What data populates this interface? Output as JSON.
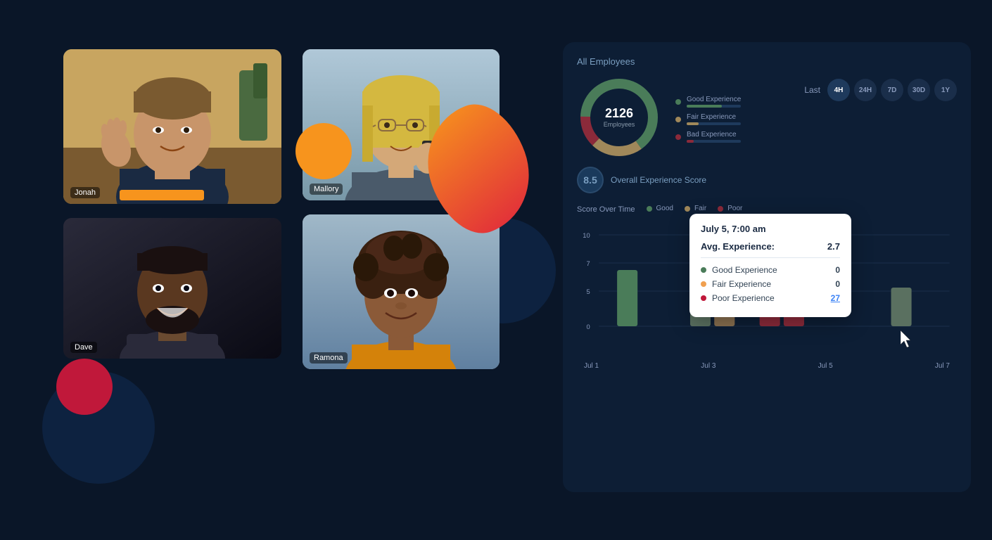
{
  "background": {
    "color": "#0a1628"
  },
  "left_panel": {
    "tiles": [
      {
        "id": "jonah",
        "name": "Jonah",
        "position": "top-left",
        "bg_color": "#8b6914"
      },
      {
        "id": "dave",
        "name": "Dave",
        "position": "bottom-left",
        "bg_color": "#1a1a1a"
      },
      {
        "id": "mallory",
        "name": "Mallory",
        "position": "top-right",
        "bg_color": "#c49040"
      },
      {
        "id": "ramona",
        "name": "Ramona",
        "position": "bottom-right",
        "bg_color": "#6b3e2c"
      }
    ]
  },
  "right_panel": {
    "section_label": "All Employees",
    "donut": {
      "value": "2126",
      "sub": "Employees",
      "good_pct": 65,
      "fair_pct": 22,
      "bad_pct": 13
    },
    "legend": [
      {
        "label": "Good Experience",
        "color": "#4a7c59",
        "pct": 65
      },
      {
        "label": "Fair Experience",
        "color": "#a0885a",
        "pct": 22
      },
      {
        "label": "Bad Experience",
        "color": "#8b2a3a",
        "pct": 13
      }
    ],
    "time_filter": {
      "label": "Last",
      "options": [
        "4H",
        "24H",
        "7D",
        "30D",
        "1Y"
      ],
      "active": "4H"
    },
    "score": {
      "value": "8.5",
      "label": "Overall Experience Score"
    },
    "chart": {
      "title": "Score Over Time",
      "legend": [
        {
          "label": "Good",
          "color": "#4a7c59"
        },
        {
          "label": "Fair",
          "color": "#a0885a"
        },
        {
          "label": "Poor",
          "color": "#8b2a3a"
        }
      ],
      "x_labels": [
        "Jul 1",
        "Jul 3",
        "Jul 5",
        "Jul 7"
      ],
      "y_labels": [
        "10",
        "7",
        "5",
        "0"
      ],
      "bars": [
        {
          "x": "Jul 1",
          "good": 70,
          "fair": 0,
          "poor": 0
        },
        {
          "x": "Jul 3",
          "good": 50,
          "fair": 30,
          "poor": 10
        },
        {
          "x": "Jul 5",
          "good": 0,
          "fair": 0,
          "poor": 80
        },
        {
          "x": "Jul 5b",
          "good": 0,
          "fair": 0,
          "poor": 60
        },
        {
          "x": "Jul 7",
          "good": 45,
          "fair": 0,
          "poor": 0
        }
      ]
    },
    "tooltip": {
      "date": "July 5, 7:00 am",
      "avg_label": "Avg. Experience:",
      "avg_value": "2.7",
      "rows": [
        {
          "label": "Good Experience",
          "color": "#4a7c59",
          "value": "0",
          "is_link": false
        },
        {
          "label": "Fair Experience",
          "color": "#f0a050",
          "value": "0",
          "is_link": false
        },
        {
          "label": "Poor Experience",
          "color": "#c0183a",
          "value": "27",
          "is_link": true
        }
      ]
    }
  }
}
